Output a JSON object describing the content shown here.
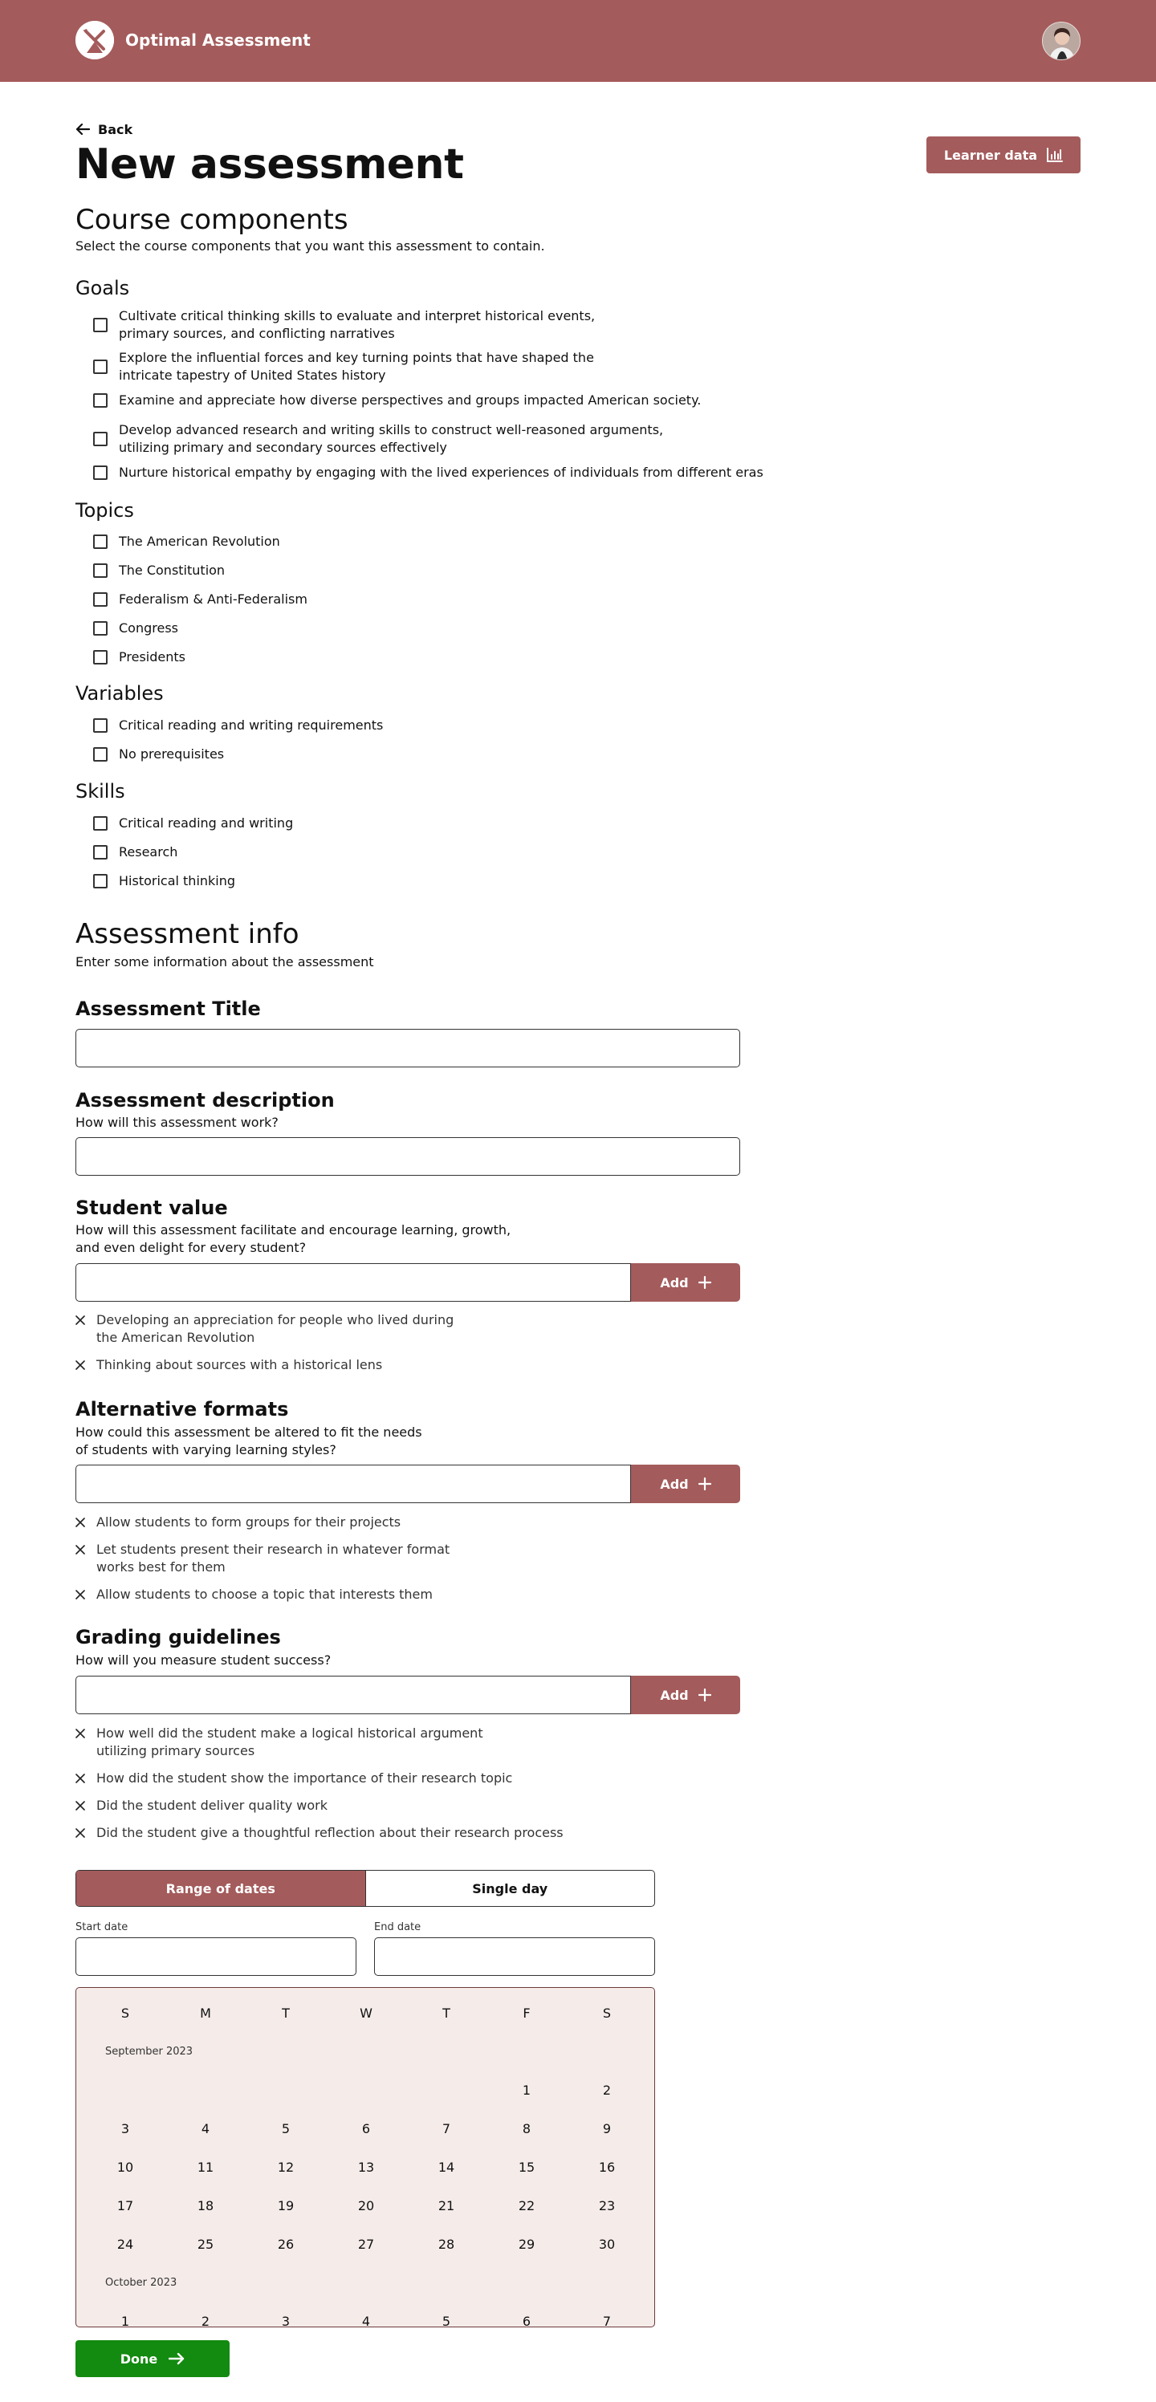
{
  "header": {
    "brand": "Optimal Assessment",
    "logo_icon": "pen-tool-icon",
    "avatar_icon": "user-avatar"
  },
  "nav": {
    "back_label": "Back",
    "back_icon": "arrow-left-icon"
  },
  "page": {
    "title": "New assessment",
    "learner_data_label": "Learner data",
    "learner_data_icon": "bar-chart-icon"
  },
  "course_components": {
    "heading": "Course components",
    "subtitle": "Select the course components that you want this assessment to contain.",
    "goals": {
      "heading": "Goals",
      "items": [
        [
          "Cultivate critical thinking skills to evaluate and interpret historical events,",
          "primary sources, and conflicting narratives"
        ],
        [
          "Explore the influential forces and key turning points that have shaped the",
          "intricate tapestry of United States history"
        ],
        [
          "Examine and appreciate how diverse perspectives and groups impacted American society.",
          ""
        ],
        [
          "Develop advanced research and writing skills to construct well-reasoned arguments,",
          "utilizing primary and secondary sources effectively"
        ],
        [
          "Nurture historical empathy by engaging with the lived experiences of individuals from different eras",
          ""
        ]
      ]
    },
    "topics": {
      "heading": "Topics",
      "items": [
        "The American Revolution",
        "The Constitution",
        "Federalism & Anti-Federalism",
        "Congress",
        "Presidents"
      ]
    },
    "variables": {
      "heading": "Variables",
      "items": [
        "Critical reading and writing requirements",
        "No prerequisites"
      ]
    },
    "skills": {
      "heading": "Skills",
      "items": [
        "Critical reading and writing",
        "Research",
        "Historical thinking"
      ]
    }
  },
  "assessment_info": {
    "heading": "Assessment info",
    "subtitle": "Enter some information about the assessment",
    "title_field": {
      "label": "Assessment Title",
      "value": ""
    },
    "description_field": {
      "label": "Assessment description",
      "help": "How will this assessment work?",
      "value": ""
    },
    "student_value": {
      "label": "Student value",
      "help": [
        "How will this assessment facilitate and encourage learning, growth,",
        "and even delight for every student?"
      ],
      "add_label": "Add",
      "value": "",
      "entries": [
        [
          "Developing an appreciation for people who lived during",
          "the American Revolution"
        ],
        [
          "Thinking about sources with a historical lens",
          ""
        ]
      ]
    },
    "alternative_formats": {
      "label": "Alternative formats",
      "help": [
        "How could this assessment be altered to fit the needs",
        "of students with varying learning styles?"
      ],
      "add_label": "Add",
      "value": "",
      "entries": [
        [
          "Allow students to form groups for their projects",
          ""
        ],
        [
          "Let students present their research in whatever format",
          "works best for them"
        ],
        [
          "Allow students to choose a topic that interests them",
          ""
        ]
      ]
    },
    "grading_guidelines": {
      "label": "Grading guidelines",
      "help": "How will you measure student success?",
      "add_label": "Add",
      "value": "",
      "entries": [
        [
          "How well did the student make a logical historical argument",
          "utilizing primary sources"
        ],
        [
          "How did the student show the importance of their research topic",
          ""
        ],
        [
          "Did the student deliver quality work",
          ""
        ],
        [
          "Did the student give a thoughtful reflection about their research process",
          ""
        ]
      ]
    }
  },
  "date_picker": {
    "mode_range": "Range of dates",
    "mode_single": "Single day",
    "selected_mode": "range",
    "start_label": "Start date",
    "end_label": "End date",
    "start_value": "",
    "end_value": "",
    "weekdays": [
      "S",
      "M",
      "T",
      "W",
      "T",
      "F",
      "S"
    ],
    "months": [
      {
        "name": "September 2023",
        "weeks": [
          [
            "",
            "",
            "",
            "",
            "",
            "1",
            "2"
          ],
          [
            "3",
            "4",
            "5",
            "6",
            "7",
            "8",
            "9"
          ],
          [
            "10",
            "11",
            "12",
            "13",
            "14",
            "15",
            "16"
          ],
          [
            "17",
            "18",
            "19",
            "20",
            "21",
            "22",
            "23"
          ],
          [
            "24",
            "25",
            "26",
            "27",
            "28",
            "29",
            "30"
          ]
        ]
      },
      {
        "name": "October 2023",
        "weeks": [
          [
            "1",
            "2",
            "3",
            "4",
            "5",
            "6",
            "7"
          ]
        ]
      }
    ]
  },
  "footer": {
    "done_label": "Done",
    "done_icon": "arrow-right-icon"
  },
  "colors": {
    "brand": "#a45b5b",
    "calendar_bg": "#f5ecea",
    "done": "#138a10"
  }
}
